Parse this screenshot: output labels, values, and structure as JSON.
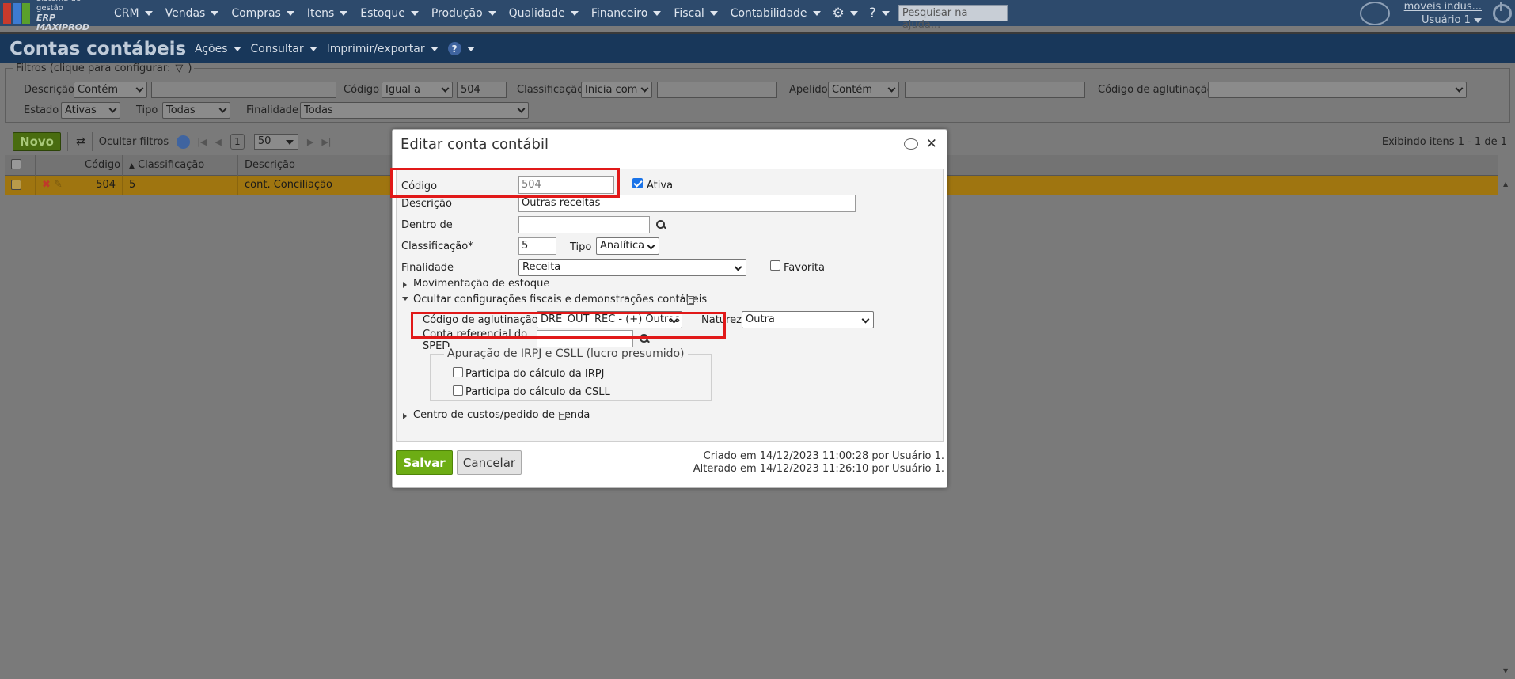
{
  "app": {
    "brand_line1": "Sistema de gestão",
    "brand_line2": "ERP MAXIPROD",
    "colors": {
      "nav": "#2d4a6c",
      "header": "#18375a",
      "primary_button": "#6dad14",
      "highlight": "#e11919"
    }
  },
  "nav": {
    "items": [
      "CRM",
      "Vendas",
      "Compras",
      "Itens",
      "Estoque",
      "Produção",
      "Qualidade",
      "Financeiro",
      "Fiscal",
      "Contabilidade"
    ],
    "search_placeholder": "Pesquisar na ajuda...",
    "user_company": "moveis indus...",
    "user_name": "Usuário 1"
  },
  "page": {
    "title": "Contas contábeis",
    "menus": [
      "Ações",
      "Consultar",
      "Imprimir/exportar"
    ]
  },
  "filters": {
    "legend": "Filtros (clique para configurar:",
    "legend_close": ")",
    "descricao_label": "Descrição",
    "descricao_op": "Contém",
    "codigo_label": "Código",
    "codigo_op": "Igual a",
    "codigo_value": "504",
    "classificacao_label": "Classificação",
    "classificacao_op": "Inicia com",
    "apelido_label": "Apelido",
    "apelido_op": "Contém",
    "aglutinacao_label": "Código de aglutinação",
    "estado_label": "Estado",
    "estado_value": "Ativas",
    "tipo_label": "Tipo",
    "tipo_value": "Todas",
    "finalidade_label": "Finalidade",
    "finalidade_value": "Todas"
  },
  "toolbar": {
    "new_label": "Novo",
    "hide_filters": "Ocultar filtros",
    "page": "1",
    "page_size": "50",
    "showing": "Exibindo itens 1 - 1 de 1"
  },
  "grid": {
    "headers": {
      "codigo": "Código",
      "classificacao": "Classificação",
      "descricao": "Descrição"
    },
    "rows": [
      {
        "codigo": "504",
        "classificacao": "5",
        "descricao": "cont. Conciliação"
      }
    ]
  },
  "modal": {
    "title": "Editar conta contábil",
    "codigo_label": "Código",
    "codigo_value": "504",
    "ativa_label": "Ativa",
    "ativa_checked": true,
    "descricao_label": "Descrição",
    "descricao_value": "Outras receitas",
    "dentro_label": "Dentro de",
    "dentro_value": "",
    "classificacao_label": "Classificação*",
    "classificacao_value": "5",
    "tipo_label": "Tipo",
    "tipo_value": "Analítica",
    "finalidade_label": "Finalidade",
    "finalidade_value": "Receita",
    "favorita_label": "Favorita",
    "mov_estoque_label": "Movimentação de estoque",
    "fiscal_section_label": "Ocultar configurações fiscais e demonstrações contábeis",
    "aglutinacao_label": "Código de aglutinação",
    "aglutinacao_value": "DRE_OUT_REC - (+) Outras Rec",
    "natureza_label": "Natureza",
    "natureza_value": "Outra",
    "sped_label_1": "Conta referencial do",
    "sped_label_2": "SPED",
    "sped_value": "",
    "irpj_legend": "Apuração de IRPJ e CSLL (lucro presumido)",
    "irpj_label": "Participa do cálculo da IRPJ",
    "csll_label": "Participa do cálculo da CSLL",
    "centro_label": "Centro de custos/pedido de venda",
    "save_label": "Salvar",
    "cancel_label": "Cancelar",
    "created": "Criado em 14/12/2023 11:00:28 por Usuário 1.",
    "altered": "Alterado em 14/12/2023 11:26:10 por Usuário 1."
  }
}
